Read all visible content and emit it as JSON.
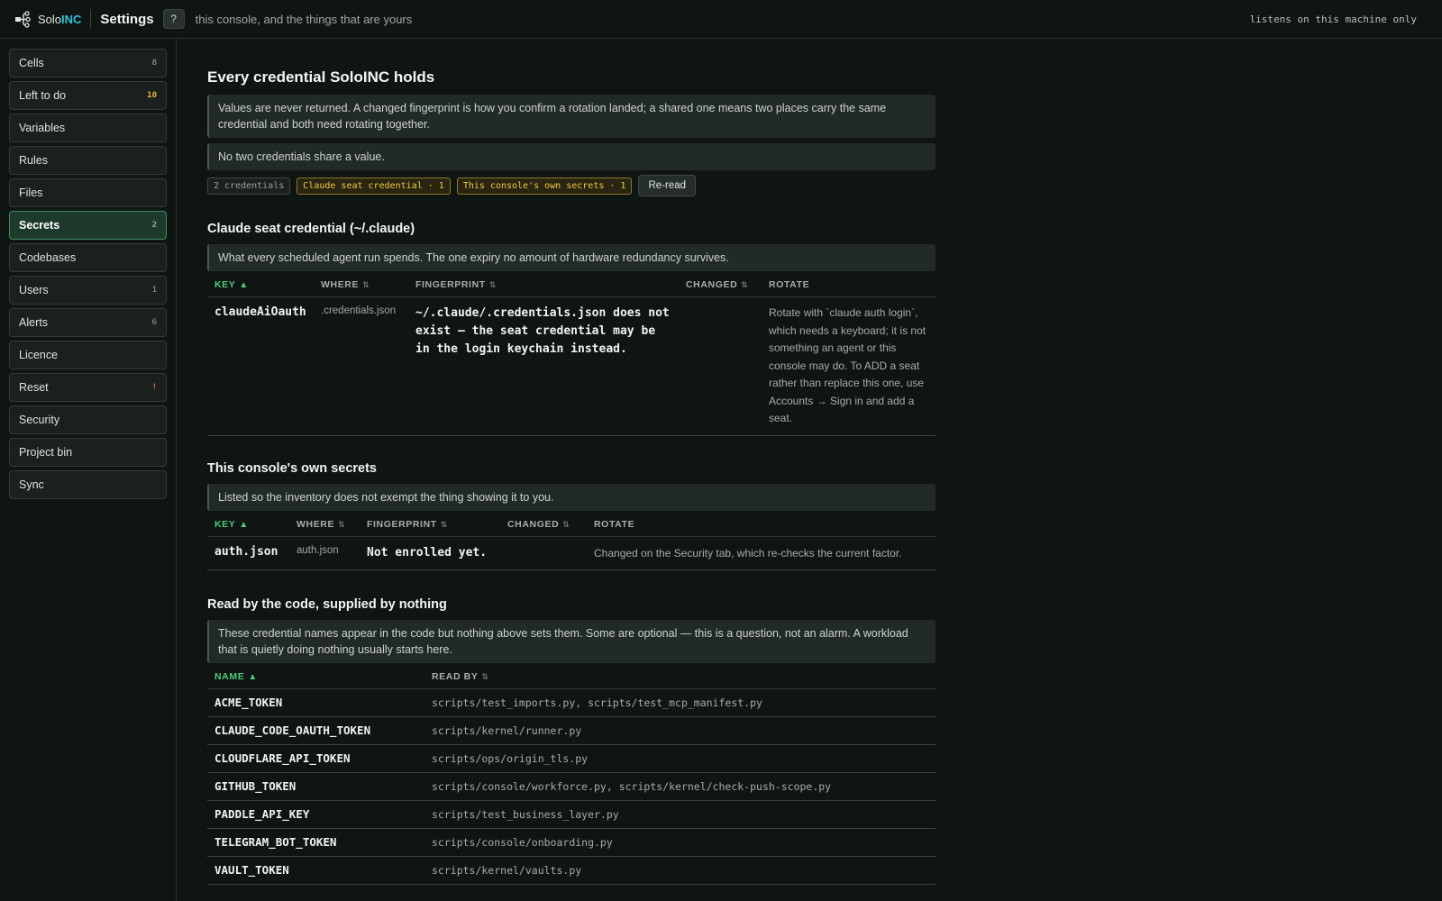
{
  "header": {
    "brand_prefix": "Solo",
    "brand_accent": "INC",
    "title": "Settings",
    "help_label": "?",
    "subtitle": "this console, and the things that are yours",
    "status": "listens on this machine only"
  },
  "sidebar": {
    "items": [
      {
        "label": "Cells",
        "count": "8"
      },
      {
        "label": "Left to do",
        "count": "10"
      },
      {
        "label": "Variables",
        "count": ""
      },
      {
        "label": "Rules",
        "count": ""
      },
      {
        "label": "Files",
        "count": ""
      },
      {
        "label": "Secrets",
        "count": "2"
      },
      {
        "label": "Codebases",
        "count": ""
      },
      {
        "label": "Users",
        "count": "1"
      },
      {
        "label": "Alerts",
        "count": "6"
      },
      {
        "label": "Licence",
        "count": ""
      },
      {
        "label": "Reset",
        "count": "!"
      },
      {
        "label": "Security",
        "count": ""
      },
      {
        "label": "Project bin",
        "count": ""
      },
      {
        "label": "Sync",
        "count": ""
      }
    ]
  },
  "main": {
    "title": "Every credential SoloINC holds",
    "intro": "Values are never returned. A changed fingerprint is how you confirm a rotation landed; a shared one means two places carry the same credential and both need rotating together.",
    "shared_note": "No two credentials share a value.",
    "badges": {
      "count": "2 credentials",
      "claude": "Claude seat credential · 1",
      "console": "This console's own secrets · 1",
      "reread": "Re-read"
    },
    "claude_section": {
      "title": "Claude seat credential (~/.claude)",
      "note": "What every scheduled agent run spends. The one expiry no amount of hardware redundancy survives.",
      "headers": {
        "key": "KEY",
        "where": "WHERE",
        "fingerprint": "FINGERPRINT",
        "changed": "CHANGED",
        "rotate": "ROTATE"
      },
      "row": {
        "key": "claudeAiOauth",
        "where": ".credentials.json",
        "fingerprint": "~/.claude/.credentials.json does not exist — the seat credential may be in the login keychain instead.",
        "changed": "",
        "rotate": "Rotate with `claude auth login`, which needs a keyboard; it is not something an agent or this console may do. To ADD a seat rather than replace this one, use Accounts → Sign in and add a seat."
      }
    },
    "console_section": {
      "title": "This console's own secrets",
      "note": "Listed so the inventory does not exempt the thing showing it to you.",
      "headers": {
        "key": "KEY",
        "where": "WHERE",
        "fingerprint": "FINGERPRINT",
        "changed": "CHANGED",
        "rotate": "ROTATE"
      },
      "row": {
        "key": "auth.json",
        "where": "auth.json",
        "fingerprint": "Not enrolled yet.",
        "changed": "",
        "rotate": "Changed on the Security tab, which re-checks the current factor."
      }
    },
    "unsupplied_section": {
      "title": "Read by the code, supplied by nothing",
      "note": "These credential names appear in the code but nothing above sets them. Some are optional — this is a question, not an alarm. A workload that is quietly doing nothing usually starts here.",
      "headers": {
        "name": "NAME",
        "read_by": "READ BY"
      },
      "rows": [
        {
          "name": "ACME_TOKEN",
          "read_by": "scripts/test_imports.py, scripts/test_mcp_manifest.py"
        },
        {
          "name": "CLAUDE_CODE_OAUTH_TOKEN",
          "read_by": "scripts/kernel/runner.py"
        },
        {
          "name": "CLOUDFLARE_API_TOKEN",
          "read_by": "scripts/ops/origin_tls.py"
        },
        {
          "name": "GITHUB_TOKEN",
          "read_by": "scripts/console/workforce.py, scripts/kernel/check-push-scope.py"
        },
        {
          "name": "PADDLE_API_KEY",
          "read_by": "scripts/test_business_layer.py"
        },
        {
          "name": "TELEGRAM_BOT_TOKEN",
          "read_by": "scripts/console/onboarding.py"
        },
        {
          "name": "VAULT_TOKEN",
          "read_by": "scripts/kernel/vaults.py"
        }
      ]
    }
  }
}
